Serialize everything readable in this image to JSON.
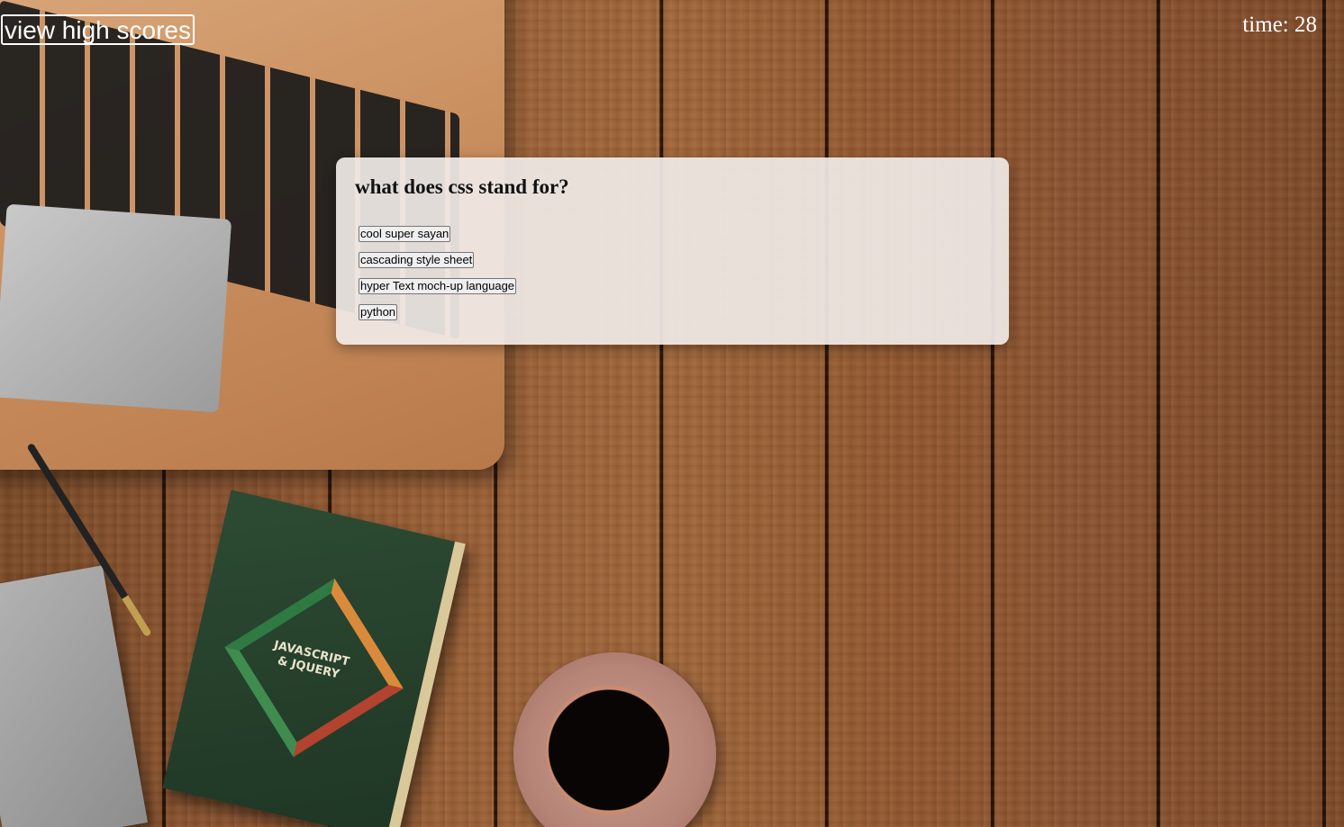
{
  "header": {
    "high_scores_label": "view high scores",
    "timer_label": "time:",
    "timer_value": "28"
  },
  "quiz": {
    "question": "what does css stand for?",
    "answers": [
      {
        "label": "cool super sayan"
      },
      {
        "label": "cascading style sheet"
      },
      {
        "label": "hyper Text moch-up language"
      },
      {
        "label": "python"
      }
    ]
  },
  "background": {
    "book_title_line1": "JAVASCRIPT",
    "book_title_line2": "& JQUERY"
  },
  "colors": {
    "header_text": "#ffffff",
    "card_background": "#f0eae6",
    "wood": "#9a6036"
  }
}
